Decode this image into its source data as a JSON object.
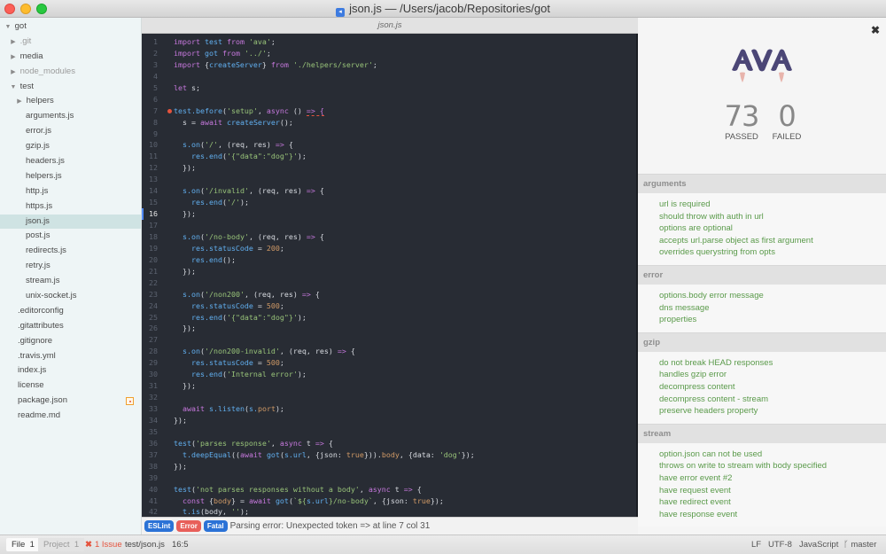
{
  "window": {
    "title": "json.js — /Users/jacob/Repositories/got",
    "app_icon": "vscode-file-icon"
  },
  "sidebar": {
    "items": [
      {
        "label": "got",
        "depth": 0,
        "arrow": "▼",
        "dim": false
      },
      {
        "label": ".git",
        "depth": 1,
        "arrow": "▶",
        "dim": true
      },
      {
        "label": "media",
        "depth": 1,
        "arrow": "▶",
        "dim": false
      },
      {
        "label": "node_modules",
        "depth": 1,
        "arrow": "▶",
        "dim": true
      },
      {
        "label": "test",
        "depth": 1,
        "arrow": "▼",
        "dim": false
      },
      {
        "label": "helpers",
        "depth": 2,
        "arrow": "▶",
        "dim": false
      },
      {
        "label": "arguments.js",
        "depth": 2,
        "arrow": "",
        "dim": false
      },
      {
        "label": "error.js",
        "depth": 2,
        "arrow": "",
        "dim": false
      },
      {
        "label": "gzip.js",
        "depth": 2,
        "arrow": "",
        "dim": false
      },
      {
        "label": "headers.js",
        "depth": 2,
        "arrow": "",
        "dim": false
      },
      {
        "label": "helpers.js",
        "depth": 2,
        "arrow": "",
        "dim": false
      },
      {
        "label": "http.js",
        "depth": 2,
        "arrow": "",
        "dim": false
      },
      {
        "label": "https.js",
        "depth": 2,
        "arrow": "",
        "dim": false
      },
      {
        "label": "json.js",
        "depth": 2,
        "arrow": "",
        "dim": false,
        "selected": true
      },
      {
        "label": "post.js",
        "depth": 2,
        "arrow": "",
        "dim": false
      },
      {
        "label": "redirects.js",
        "depth": 2,
        "arrow": "",
        "dim": false
      },
      {
        "label": "retry.js",
        "depth": 2,
        "arrow": "",
        "dim": false
      },
      {
        "label": "stream.js",
        "depth": 2,
        "arrow": "",
        "dim": false
      },
      {
        "label": "unix-socket.js",
        "depth": 2,
        "arrow": "",
        "dim": false
      },
      {
        "label": ".editorconfig",
        "depth": 1,
        "arrow": "",
        "dim": false
      },
      {
        "label": ".gitattributes",
        "depth": 1,
        "arrow": "",
        "dim": false
      },
      {
        "label": ".gitignore",
        "depth": 1,
        "arrow": "",
        "dim": false
      },
      {
        "label": ".travis.yml",
        "depth": 1,
        "arrow": "",
        "dim": false
      },
      {
        "label": "index.js",
        "depth": 1,
        "arrow": "",
        "dim": false
      },
      {
        "label": "license",
        "depth": 1,
        "arrow": "",
        "dim": false
      },
      {
        "label": "package.json",
        "depth": 1,
        "arrow": "",
        "dim": false,
        "modified": true
      },
      {
        "label": "readme.md",
        "depth": 1,
        "arrow": "",
        "dim": false
      }
    ]
  },
  "editor": {
    "tab_title": "json.js",
    "active_line": 16,
    "error_line": 7,
    "lines": [
      [
        [
          "kw",
          "import "
        ],
        [
          "fn",
          "test "
        ],
        [
          "kw",
          "from "
        ],
        [
          "str",
          "'ava'"
        ],
        [
          "plain",
          ";"
        ]
      ],
      [
        [
          "kw",
          "import "
        ],
        [
          "fn",
          "got "
        ],
        [
          "kw",
          "from "
        ],
        [
          "str",
          "'../'"
        ],
        [
          "plain",
          ";"
        ]
      ],
      [
        [
          "kw",
          "import "
        ],
        [
          "plain",
          "{"
        ],
        [
          "fn",
          "createServer"
        ],
        [
          "plain",
          "} "
        ],
        [
          "kw",
          "from "
        ],
        [
          "str",
          "'./helpers/server'"
        ],
        [
          "plain",
          ";"
        ]
      ],
      [],
      [
        [
          "kw",
          "let "
        ],
        [
          "plain",
          "s;"
        ]
      ],
      [],
      [
        [
          "fn",
          "test.before"
        ],
        [
          "plain",
          "("
        ],
        [
          "str",
          "'setup'"
        ],
        [
          "plain",
          ", "
        ],
        [
          "kw",
          "async "
        ],
        [
          "plain",
          "() "
        ],
        [
          "err",
          "=> {"
        ]
      ],
      [
        [
          "plain",
          "  s = "
        ],
        [
          "kw",
          "await "
        ],
        [
          "fn",
          "createServer"
        ],
        [
          "plain",
          "();"
        ]
      ],
      [],
      [
        [
          "plain",
          "  "
        ],
        [
          "fn",
          "s.on"
        ],
        [
          "plain",
          "("
        ],
        [
          "str",
          "'/'"
        ],
        [
          "plain",
          ", (req, res) "
        ],
        [
          "kw",
          "=> "
        ],
        [
          "plain",
          "{"
        ]
      ],
      [
        [
          "plain",
          "    "
        ],
        [
          "fn",
          "res.end"
        ],
        [
          "plain",
          "("
        ],
        [
          "str",
          "'{\"data\":\"dog\"}'"
        ],
        [
          "plain",
          ");"
        ]
      ],
      [
        [
          "plain",
          "  });"
        ]
      ],
      [],
      [
        [
          "plain",
          "  "
        ],
        [
          "fn",
          "s.on"
        ],
        [
          "plain",
          "("
        ],
        [
          "str",
          "'/invalid'"
        ],
        [
          "plain",
          ", (req, res) "
        ],
        [
          "kw",
          "=> "
        ],
        [
          "plain",
          "{"
        ]
      ],
      [
        [
          "plain",
          "    "
        ],
        [
          "fn",
          "res.end"
        ],
        [
          "plain",
          "("
        ],
        [
          "str",
          "'/'"
        ],
        [
          "plain",
          ");"
        ]
      ],
      [
        [
          "plain",
          "  });"
        ]
      ],
      [],
      [
        [
          "plain",
          "  "
        ],
        [
          "fn",
          "s.on"
        ],
        [
          "plain",
          "("
        ],
        [
          "str",
          "'/no-body'"
        ],
        [
          "plain",
          ", (req, res) "
        ],
        [
          "kw",
          "=> "
        ],
        [
          "plain",
          "{"
        ]
      ],
      [
        [
          "plain",
          "    "
        ],
        [
          "fn",
          "res.statusCode"
        ],
        [
          "plain",
          " = "
        ],
        [
          "num",
          "200"
        ],
        [
          "plain",
          ";"
        ]
      ],
      [
        [
          "plain",
          "    "
        ],
        [
          "fn",
          "res.end"
        ],
        [
          "plain",
          "();"
        ]
      ],
      [
        [
          "plain",
          "  });"
        ]
      ],
      [],
      [
        [
          "plain",
          "  "
        ],
        [
          "fn",
          "s.on"
        ],
        [
          "plain",
          "("
        ],
        [
          "str",
          "'/non200'"
        ],
        [
          "plain",
          ", (req, res) "
        ],
        [
          "kw",
          "=> "
        ],
        [
          "plain",
          "{"
        ]
      ],
      [
        [
          "plain",
          "    "
        ],
        [
          "fn",
          "res.statusCode"
        ],
        [
          "plain",
          " = "
        ],
        [
          "num",
          "500"
        ],
        [
          "plain",
          ";"
        ]
      ],
      [
        [
          "plain",
          "    "
        ],
        [
          "fn",
          "res.end"
        ],
        [
          "plain",
          "("
        ],
        [
          "str",
          "'{\"data\":\"dog\"}'"
        ],
        [
          "plain",
          ");"
        ]
      ],
      [
        [
          "plain",
          "  });"
        ]
      ],
      [],
      [
        [
          "plain",
          "  "
        ],
        [
          "fn",
          "s.on"
        ],
        [
          "plain",
          "("
        ],
        [
          "str",
          "'/non200-invalid'"
        ],
        [
          "plain",
          ", (req, res) "
        ],
        [
          "kw",
          "=> "
        ],
        [
          "plain",
          "{"
        ]
      ],
      [
        [
          "plain",
          "    "
        ],
        [
          "fn",
          "res.statusCode"
        ],
        [
          "plain",
          " = "
        ],
        [
          "num",
          "500"
        ],
        [
          "plain",
          ";"
        ]
      ],
      [
        [
          "plain",
          "    "
        ],
        [
          "fn",
          "res.end"
        ],
        [
          "plain",
          "("
        ],
        [
          "str",
          "'Internal error'"
        ],
        [
          "plain",
          ");"
        ]
      ],
      [
        [
          "plain",
          "  });"
        ]
      ],
      [],
      [
        [
          "plain",
          "  "
        ],
        [
          "kw",
          "await "
        ],
        [
          "fn",
          "s.listen"
        ],
        [
          "plain",
          "("
        ],
        [
          "fn",
          "s."
        ],
        [
          "num",
          "port"
        ],
        [
          "plain",
          ");"
        ]
      ],
      [
        [
          "plain",
          "});"
        ]
      ],
      [],
      [
        [
          "fn",
          "test"
        ],
        [
          "plain",
          "("
        ],
        [
          "str",
          "'parses response'"
        ],
        [
          "plain",
          ", "
        ],
        [
          "kw",
          "async "
        ],
        [
          "plain",
          "t "
        ],
        [
          "kw",
          "=> "
        ],
        [
          "plain",
          "{"
        ]
      ],
      [
        [
          "plain",
          "  "
        ],
        [
          "fn",
          "t.deepEqual"
        ],
        [
          "plain",
          "(("
        ],
        [
          "kw",
          "await "
        ],
        [
          "fn",
          "got"
        ],
        [
          "plain",
          "("
        ],
        [
          "fn",
          "s.url"
        ],
        [
          "plain",
          ", {json: "
        ],
        [
          "num",
          "true"
        ],
        [
          "plain",
          "}))."
        ],
        [
          "num",
          "body"
        ],
        [
          "plain",
          ", {data: "
        ],
        [
          "str",
          "'dog'"
        ],
        [
          "plain",
          "});"
        ]
      ],
      [
        [
          "plain",
          "});"
        ]
      ],
      [],
      [
        [
          "fn",
          "test"
        ],
        [
          "plain",
          "("
        ],
        [
          "str",
          "'not parses responses without a body'"
        ],
        [
          "plain",
          ", "
        ],
        [
          "kw",
          "async "
        ],
        [
          "plain",
          "t "
        ],
        [
          "kw",
          "=> "
        ],
        [
          "plain",
          "{"
        ]
      ],
      [
        [
          "plain",
          "  "
        ],
        [
          "kw",
          "const "
        ],
        [
          "plain",
          "{"
        ],
        [
          "num",
          "body"
        ],
        [
          "plain",
          "} = "
        ],
        [
          "kw",
          "await "
        ],
        [
          "fn",
          "got"
        ],
        [
          "plain",
          "("
        ],
        [
          "str",
          "`${"
        ],
        [
          "fn",
          "s.url"
        ],
        [
          "str",
          "}/no-body`"
        ],
        [
          "plain",
          ", {json: "
        ],
        [
          "num",
          "true"
        ],
        [
          "plain",
          "});"
        ]
      ],
      [
        [
          "plain",
          "  "
        ],
        [
          "fn",
          "t.is"
        ],
        [
          "plain",
          "(body, "
        ],
        [
          "str",
          "''"
        ],
        [
          "plain",
          ");"
        ]
      ]
    ]
  },
  "lint": {
    "badges": {
      "linter": "ESLint",
      "type": "Error",
      "severity": "Fatal"
    },
    "message": "Parsing error: Unexpected token => at line 7 col 31"
  },
  "ava": {
    "close_icon": "close-icon",
    "passed": "73",
    "failed": "0",
    "passed_label": "PASSED",
    "failed_label": "FAILED",
    "colors": {
      "logo": "#4b4676",
      "flame": "#e8b4ac",
      "pass": "#5a9a4a"
    },
    "groups": [
      {
        "name": "arguments",
        "tests": [
          "url is required",
          "should throw with auth in url",
          "options are optional",
          "accepts url.parse object as first argument",
          "overrides querystring from opts"
        ]
      },
      {
        "name": "error",
        "tests": [
          "options.body error message",
          "dns message",
          "properties"
        ]
      },
      {
        "name": "gzip",
        "tests": [
          "do not break HEAD responses",
          "handles gzip error",
          "decompress content",
          "decompress content - stream",
          "preserve headers property"
        ]
      },
      {
        "name": "stream",
        "tests": [
          "option.json can not be used",
          "throws on write to stream with body specified",
          "have error event #2",
          "have request event",
          "have redirect event",
          "have response event"
        ]
      }
    ]
  },
  "statusbar": {
    "file_tab": "File",
    "file_count": "1",
    "project_tab": "Project",
    "project_count": "1",
    "issues": "1 Issue",
    "path": "test/json.js",
    "cursor": "16:5",
    "line_ending": "LF",
    "encoding": "UTF-8",
    "grammar": "JavaScript",
    "branch": "master"
  }
}
